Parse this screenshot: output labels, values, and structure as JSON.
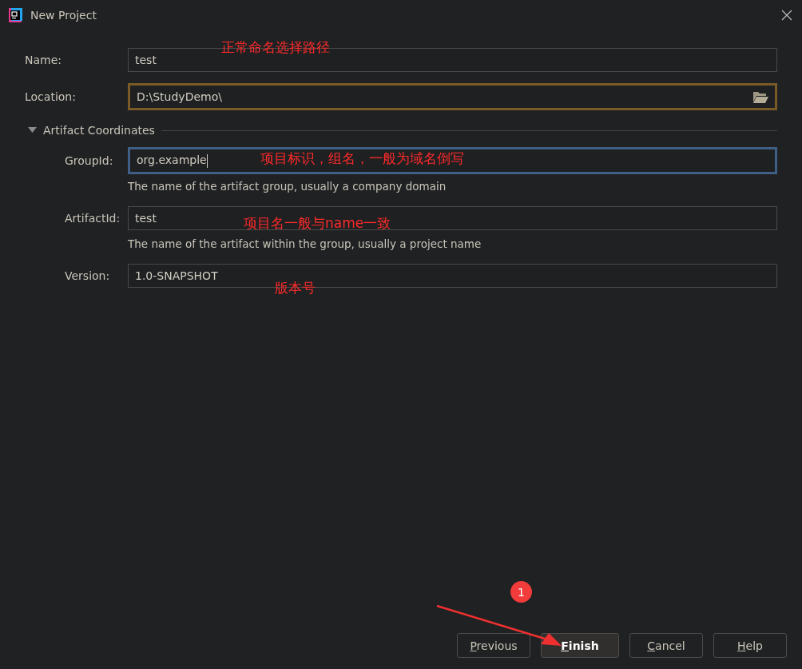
{
  "window": {
    "title": "New Project"
  },
  "fields": [
    {
      "label": "Name:",
      "value": "test",
      "focused": false,
      "warning": false
    },
    {
      "label": "Location:",
      "value": "D:\\StudyDemo\\",
      "focused": false,
      "warning": true,
      "browse": true
    }
  ],
  "section": {
    "title": "Artifact Coordinates",
    "expanded": true,
    "fields": [
      {
        "label": "GroupId:",
        "value": "org.example",
        "focused": true,
        "warning": false,
        "hint": "The name of the artifact group, usually a company domain"
      },
      {
        "label": "ArtifactId:",
        "value": "test",
        "focused": false,
        "warning": false,
        "hint": "The name of the artifact within the group, usually a project name"
      },
      {
        "label": "Version:",
        "value": "1.0-SNAPSHOT",
        "focused": false,
        "warning": false
      }
    ]
  },
  "buttons": [
    {
      "label": "Previous",
      "default": false
    },
    {
      "label": "Finish",
      "default": true
    },
    {
      "label": "Cancel",
      "default": false
    },
    {
      "label": "Help",
      "default": false
    }
  ],
  "annotations": [
    {
      "kind": "note",
      "text": "正常命名选择路径"
    },
    {
      "kind": "note",
      "text": "项目标识，组名，一般为域名倒写"
    },
    {
      "kind": "note",
      "text": "项目名一般与name一致"
    },
    {
      "kind": "note",
      "text": "版本号"
    },
    {
      "kind": "step",
      "text": "1"
    }
  ]
}
